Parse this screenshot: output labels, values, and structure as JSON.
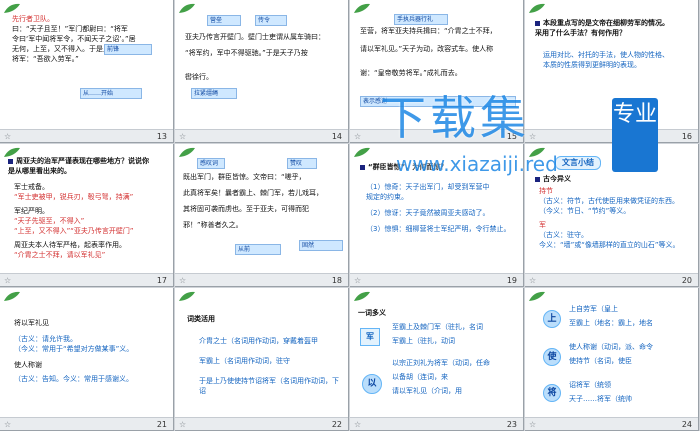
{
  "slides": [
    {
      "num": "13",
      "lines": [
        "先行者卫队。",
        "曰：“天子且至！”军门都尉曰：“将军",
        "令曰‘军中闻将军令，不闻天子之诏’。”居",
        "无何，上至，又不得入。于是上乃使使持节诏",
        "将军：“吾欲入劳军。”"
      ],
      "notes": [
        "前锋",
        "不久",
        "从……开始",
        "先行人员"
      ]
    },
    {
      "num": "14",
      "lines": [
        "亚夫乃传言开壁门。壁门士吏谓从属车骑曰：",
        "“将军约，军中不得驱驰。”于是天子乃按",
        "辔徐行。"
      ],
      "notes": [
        "营垒",
        "传令",
        "规定",
        "拉紧缰绳"
      ]
    },
    {
      "num": "15",
      "lines": [
        "至营，将军亚夫持兵揖曰：“介胄之士不拜，",
        "请以军礼见。”天子为动，改容式车。使人称",
        "谢：“皇帝敬劳将军。”成礼而去。"
      ],
      "notes": [
        "手执兵器行礼",
        "披甲",
        "凭轼致敬",
        "表示感谢"
      ]
    },
    {
      "num": "16",
      "lines": [
        "本段重点写的是文帝在细柳劳军的情况。",
        "采用了什么手法？有何作用？",
        "运用对比、衬托的手法，使人物的性格、",
        "本质的性质得到更鲜明的表现。"
      ],
      "notes": []
    },
    {
      "num": "17",
      "lines": [
        "周亚夫的治军严谨表现在哪些地方？说说你",
        "是从哪里看出来的。",
        "军士戒备。",
        "“军士吏被甲，锐兵刃，彀弓弩，持满”",
        "军纪严明。",
        "“天子先驱至，不得入”",
        "“上至，又不得入”“亚夫乃传言开壁门”",
        "周亚夫本人待军严格，起表率作用。",
        "“介胄之士不拜，请以军礼见”"
      ],
      "notes": []
    },
    {
      "num": "18",
      "lines": [
        "既出军门，群臣皆惊。文帝曰：“嗟乎，",
        "此真将军矣！曩者霸上、棘门军，若儿戏耳，",
        "其将固可袭而虏也。至于亚夫，可得而犯",
        "邪！”称善者久之。"
      ],
      "notes": [
        "感叹词",
        "从前",
        "固然",
        "以前",
        "赞叹"
      ]
    },
    {
      "num": "19",
      "lines": [
        "“群臣皆惊”，为何而惊？",
        "（1）惊奇：天子出军门，却受到军营中",
        "规定的约束。",
        "（2）惊讶：天子竟然被周亚夫感动了。",
        "（3）惊惧：细柳营将士军纪严明，令行禁止。"
      ],
      "notes": []
    },
    {
      "num": "20",
      "lines": [
        "文言小结",
        "古今异义",
        "持节",
        "（古义：符节，古代使臣用来做凭证的东西。",
        "（今义：节日、“节约”等义。",
        "军",
        "（古义：驻守。",
        "今义：“墙”或“像墙那样的直立的山石”等义。"
      ],
      "notes": []
    },
    {
      "num": "21",
      "lines": [
        "将以军礼见",
        "（古义：请允许我。",
        "（今义：常用于“希望对方做某事”义。",
        "使人称谢",
        "（古义：告知。今义：常用于感谢义。"
      ],
      "notes": []
    },
    {
      "num": "22",
      "lines": [
        "词类活用",
        "介胄之士（名词用作动词，穿戴着盔甲",
        "军霸上（名词用作动词，驻守",
        "于是上乃使使持节诏将军（名词用作动词，下诏"
      ],
      "notes": []
    },
    {
      "num": "23",
      "lines": [
        "一词多义",
        "军",
        "至霸上及棘门军（驻扎，名词",
        "军霸上（驻扎，动词",
        "以",
        "以宗正刘礼为将军（动词，任命",
        "以备胡（连词，来",
        "请以军礼见（介词，用"
      ],
      "notes": []
    },
    {
      "num": "24",
      "lines": [
        "上",
        "上自劳军（皇上",
        "至霸上（地名：霸上，地名",
        "使",
        "使人称谢（动词，派、命令",
        "使持节（名词，使臣",
        "将",
        "诏将军（统领",
        "天子……将军（统帅"
      ],
      "notes": []
    }
  ],
  "watermark": {
    "title": "下载集",
    "url": "www.xiazaiji.red",
    "badge": "专业"
  },
  "colors": {
    "header_green": "#2e7d32",
    "text_blue": "#1a237e",
    "note_bg": "#cfe8ff",
    "watermark_blue": "#1e88e5"
  }
}
